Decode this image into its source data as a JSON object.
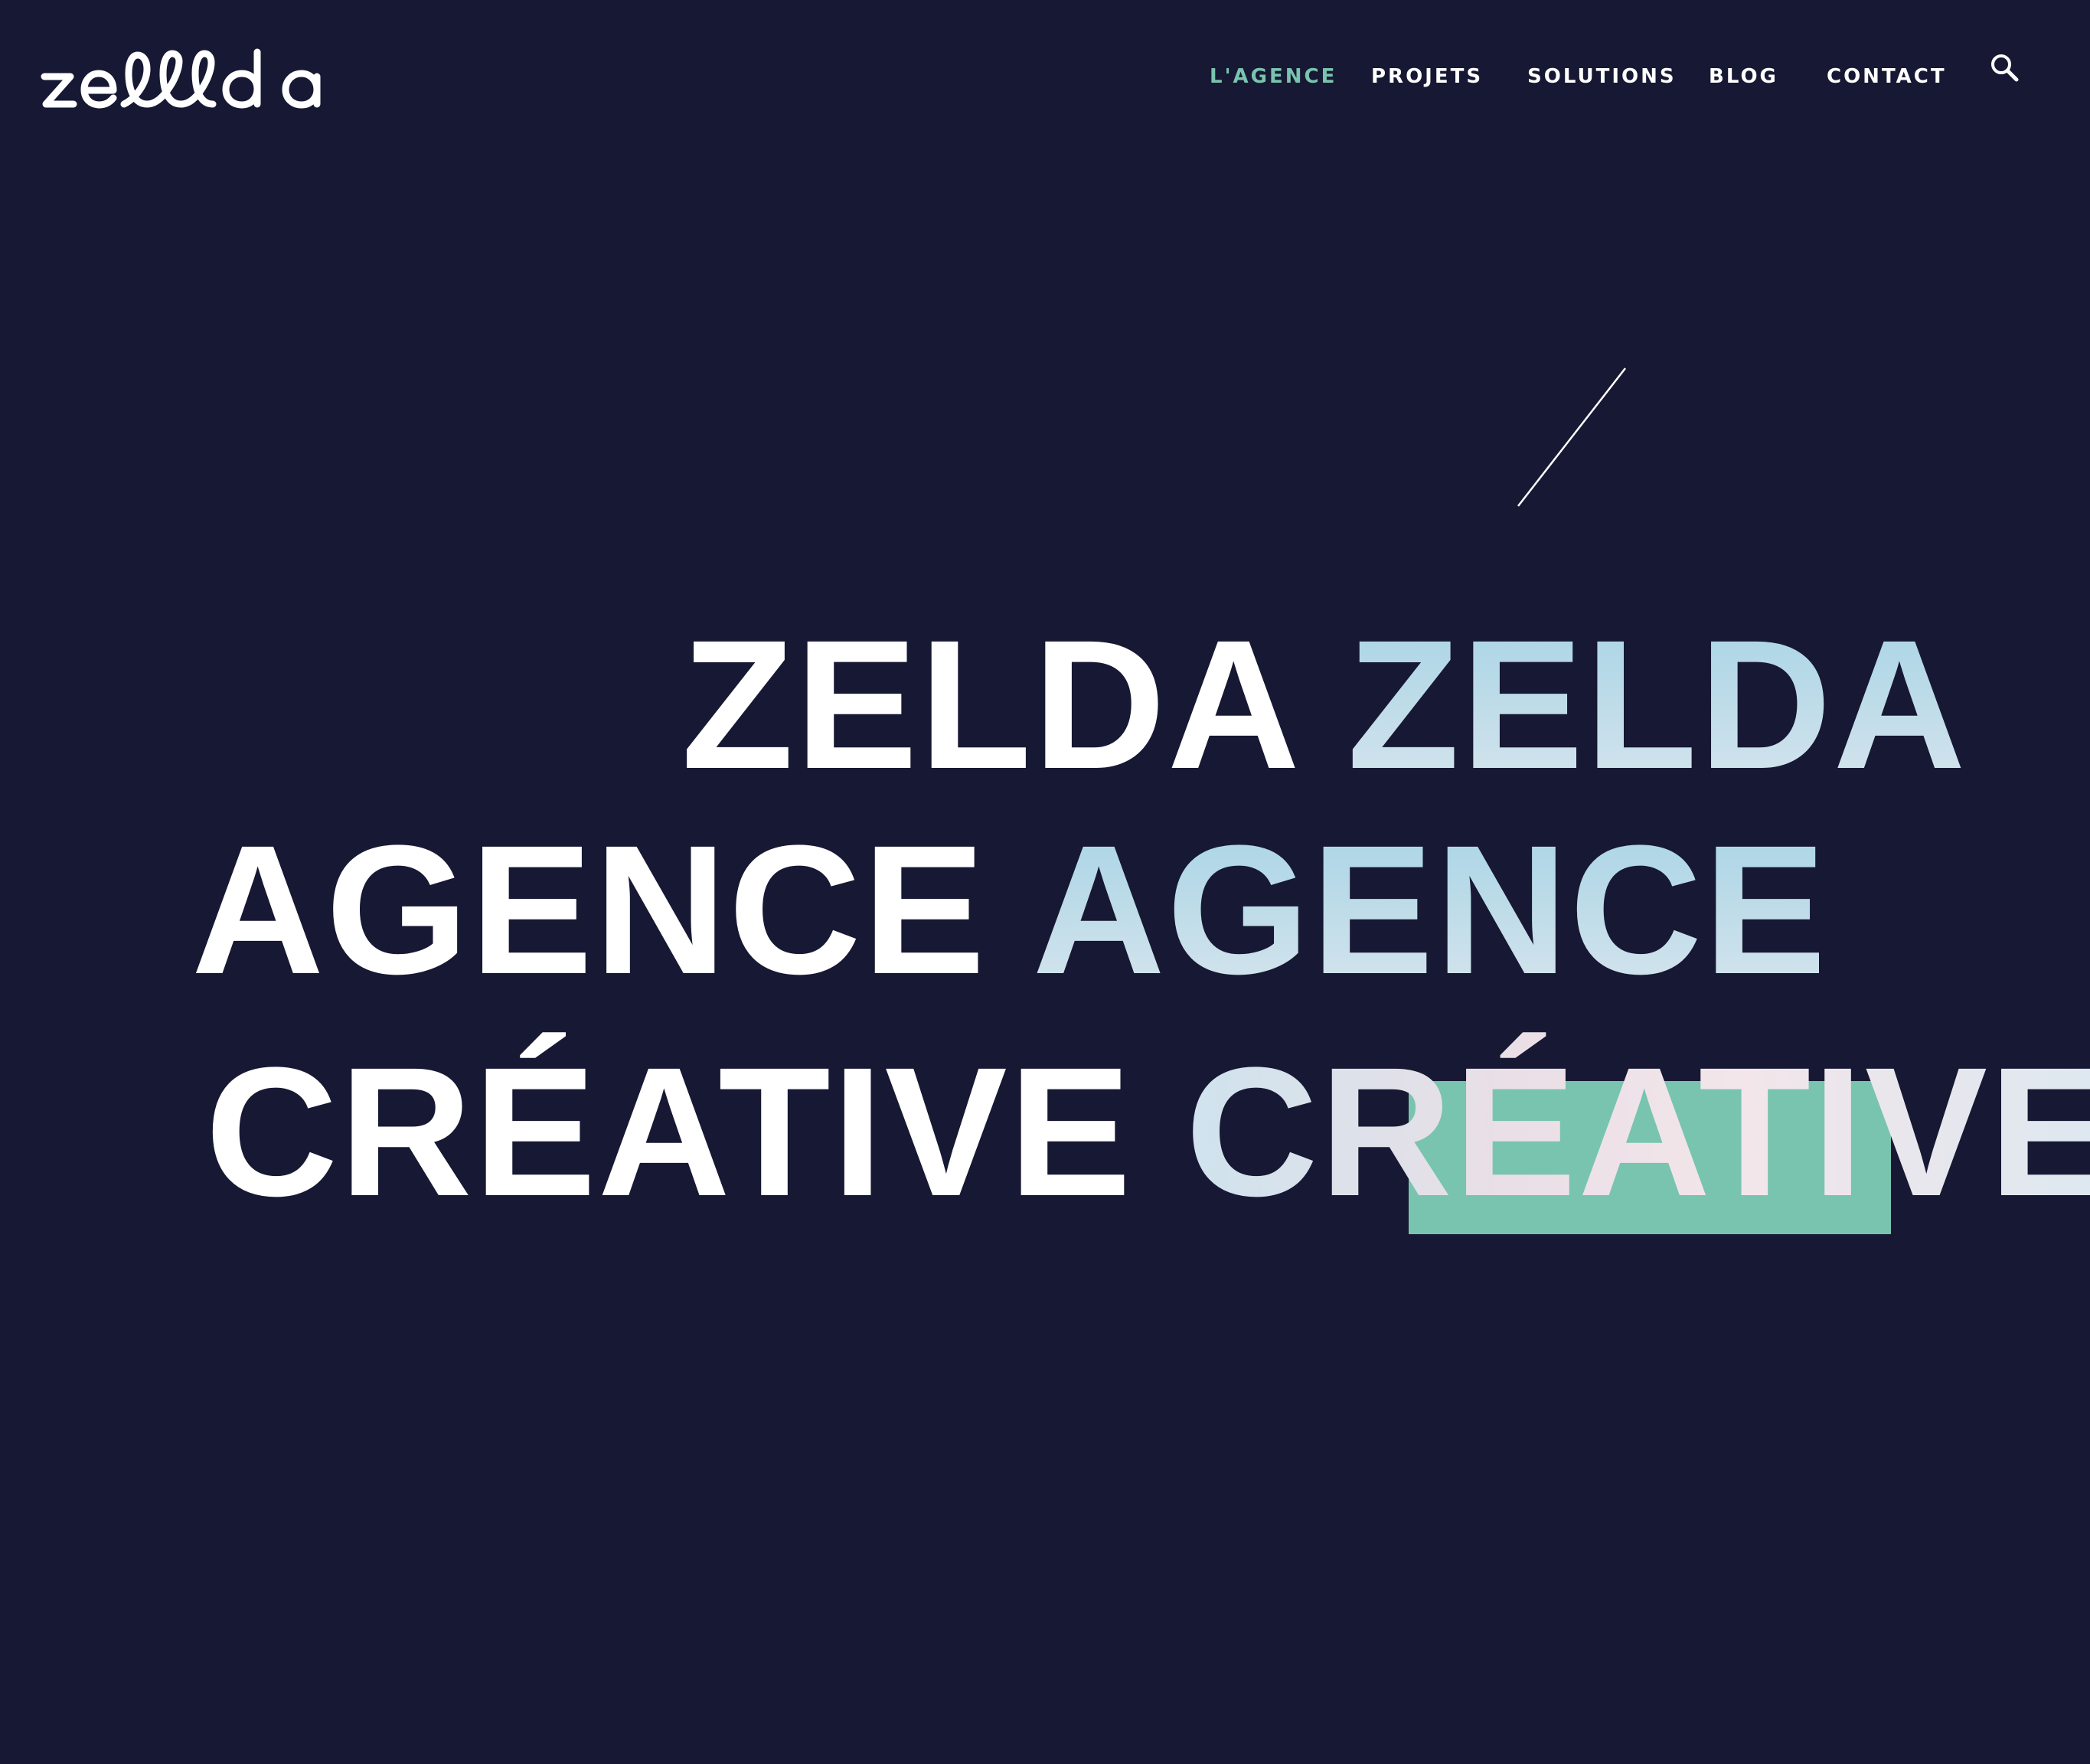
{
  "header": {
    "logo_text": "zellda",
    "logo_icon": "zellda-wordmark-logo",
    "nav": [
      {
        "label": "L'AGENCE",
        "active": true
      },
      {
        "label": "PROJETS",
        "active": false
      },
      {
        "label": "SOLUTIONS",
        "active": false
      },
      {
        "label": "BLOG",
        "active": false
      },
      {
        "label": "CONTACT",
        "active": false
      }
    ],
    "search_icon": "search-icon"
  },
  "hero": {
    "line1": {
      "solid": "ZELDA",
      "gradient": "ZELDA"
    },
    "line2": {
      "solid": "AGENCE",
      "gradient": "AGENCE"
    },
    "line3": {
      "solid": "CRÉATIVE",
      "gradient": "CRÉATIVE"
    }
  },
  "colors": {
    "background": "#171833",
    "accent": "#79c4ae",
    "text": "#ffffff",
    "gradient_text": "#b8d9e8"
  }
}
